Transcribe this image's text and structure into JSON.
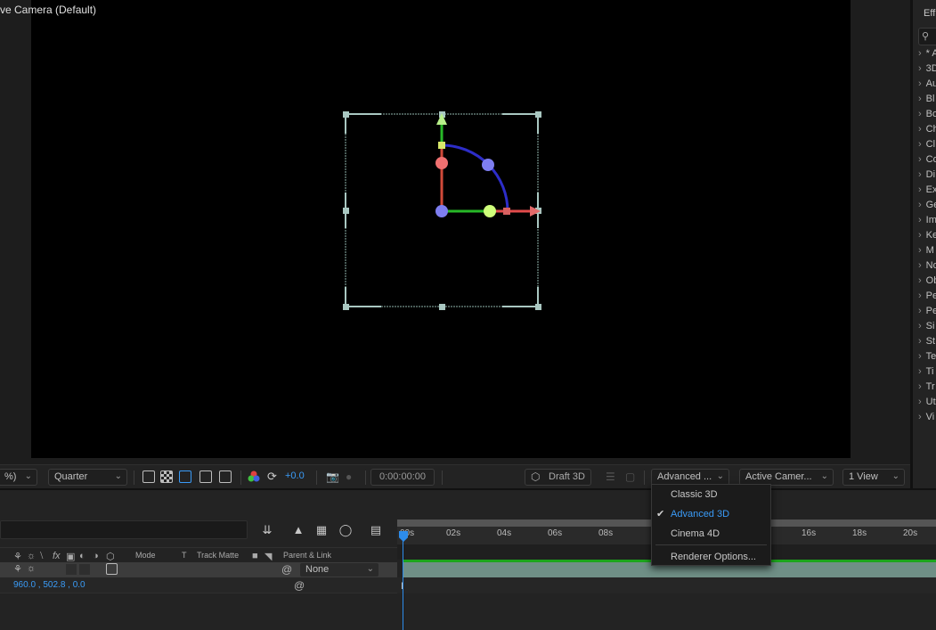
{
  "viewer": {
    "title": "ve Camera (Default)"
  },
  "effects_panel": {
    "tab": "Eff",
    "items": [
      "* A",
      "3D",
      "Au",
      "Bl",
      "Bo",
      "Ch",
      "Cl",
      "Co",
      "Di",
      "Ex",
      "Ge",
      "Im",
      "Ke",
      "M",
      "No",
      "Ob",
      "Pe",
      "Pe",
      "Si",
      "St",
      "Te",
      "Ti",
      "Tr",
      "Ut",
      "Vi"
    ]
  },
  "toolbar": {
    "zoom_value": "%)",
    "resolution": "Quarter",
    "exposure": "+0.0",
    "timecode": "0:00:00:00",
    "draft3d": "Draft 3D",
    "renderer": "Advanced ...",
    "camera": "Active Camer...",
    "views": "1 View"
  },
  "renderer_menu": {
    "items": [
      {
        "label": "Classic 3D",
        "checked": false
      },
      {
        "label": "Advanced 3D",
        "checked": true
      },
      {
        "label": "Cinema 4D",
        "checked": false
      }
    ],
    "options": "Renderer Options..."
  },
  "timeline": {
    "headers": {
      "mode": "Mode",
      "t": "T",
      "track_matte": "Track Matte",
      "parent": "Parent & Link"
    },
    "layer": {
      "parent_value": "None",
      "position_value": "960.0 , 502.8 , 0.0"
    },
    "ruler_ticks": [
      "00s",
      "02s",
      "04s",
      "06s",
      "08s",
      "16s",
      "18s",
      "20s"
    ]
  },
  "colors": {
    "accent": "#3a9bf7",
    "track": "#6f8f86",
    "x_axis": "#e24b4b",
    "y_axis": "#27b827",
    "z_axis": "#3a3ad6"
  }
}
